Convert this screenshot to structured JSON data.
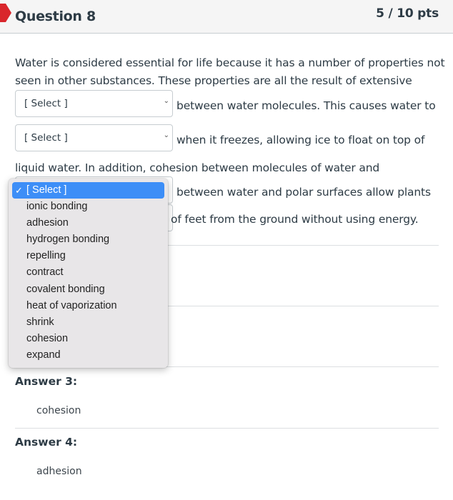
{
  "header": {
    "title": "Question 8",
    "points": "5 / 10 pts",
    "flag_color": "#d9262c"
  },
  "question": {
    "line1": "Water is considered essential for life because it has a number of properties not",
    "line2": "seen in other substances. These properties are all the result of extensive",
    "after_select1": "between water molecules. This causes water to",
    "after_select2": "when it freezes, allowing ice to float on top of",
    "line5": "liquid water. In addition, cohesion between molecules of water and",
    "after_select3": "between water and polar surfaces allow plants",
    "after_select4": "of feet from the ground without using energy.",
    "selects": [
      {
        "value": "[ Select ]"
      },
      {
        "value": "[ Select ]"
      },
      {
        "value": "[ Select ]"
      },
      {
        "value": "[ Select ]"
      }
    ],
    "chevron_glyph": "⌄"
  },
  "dropdown": {
    "check_glyph": "✓",
    "selected_index": 0,
    "options": [
      "[ Select ]",
      "ionic bonding",
      "adhesion",
      "hydrogen bonding",
      "repelling",
      "contract",
      "covalent bonding",
      "heat of vaporization",
      "shrink",
      "cohesion",
      "expand"
    ],
    "highlight_color": "#3d8ef7"
  },
  "answers": [
    {
      "label": "Answer 3:",
      "value": "cohesion"
    },
    {
      "label": "Answer 4:",
      "value": "adhesion"
    }
  ]
}
